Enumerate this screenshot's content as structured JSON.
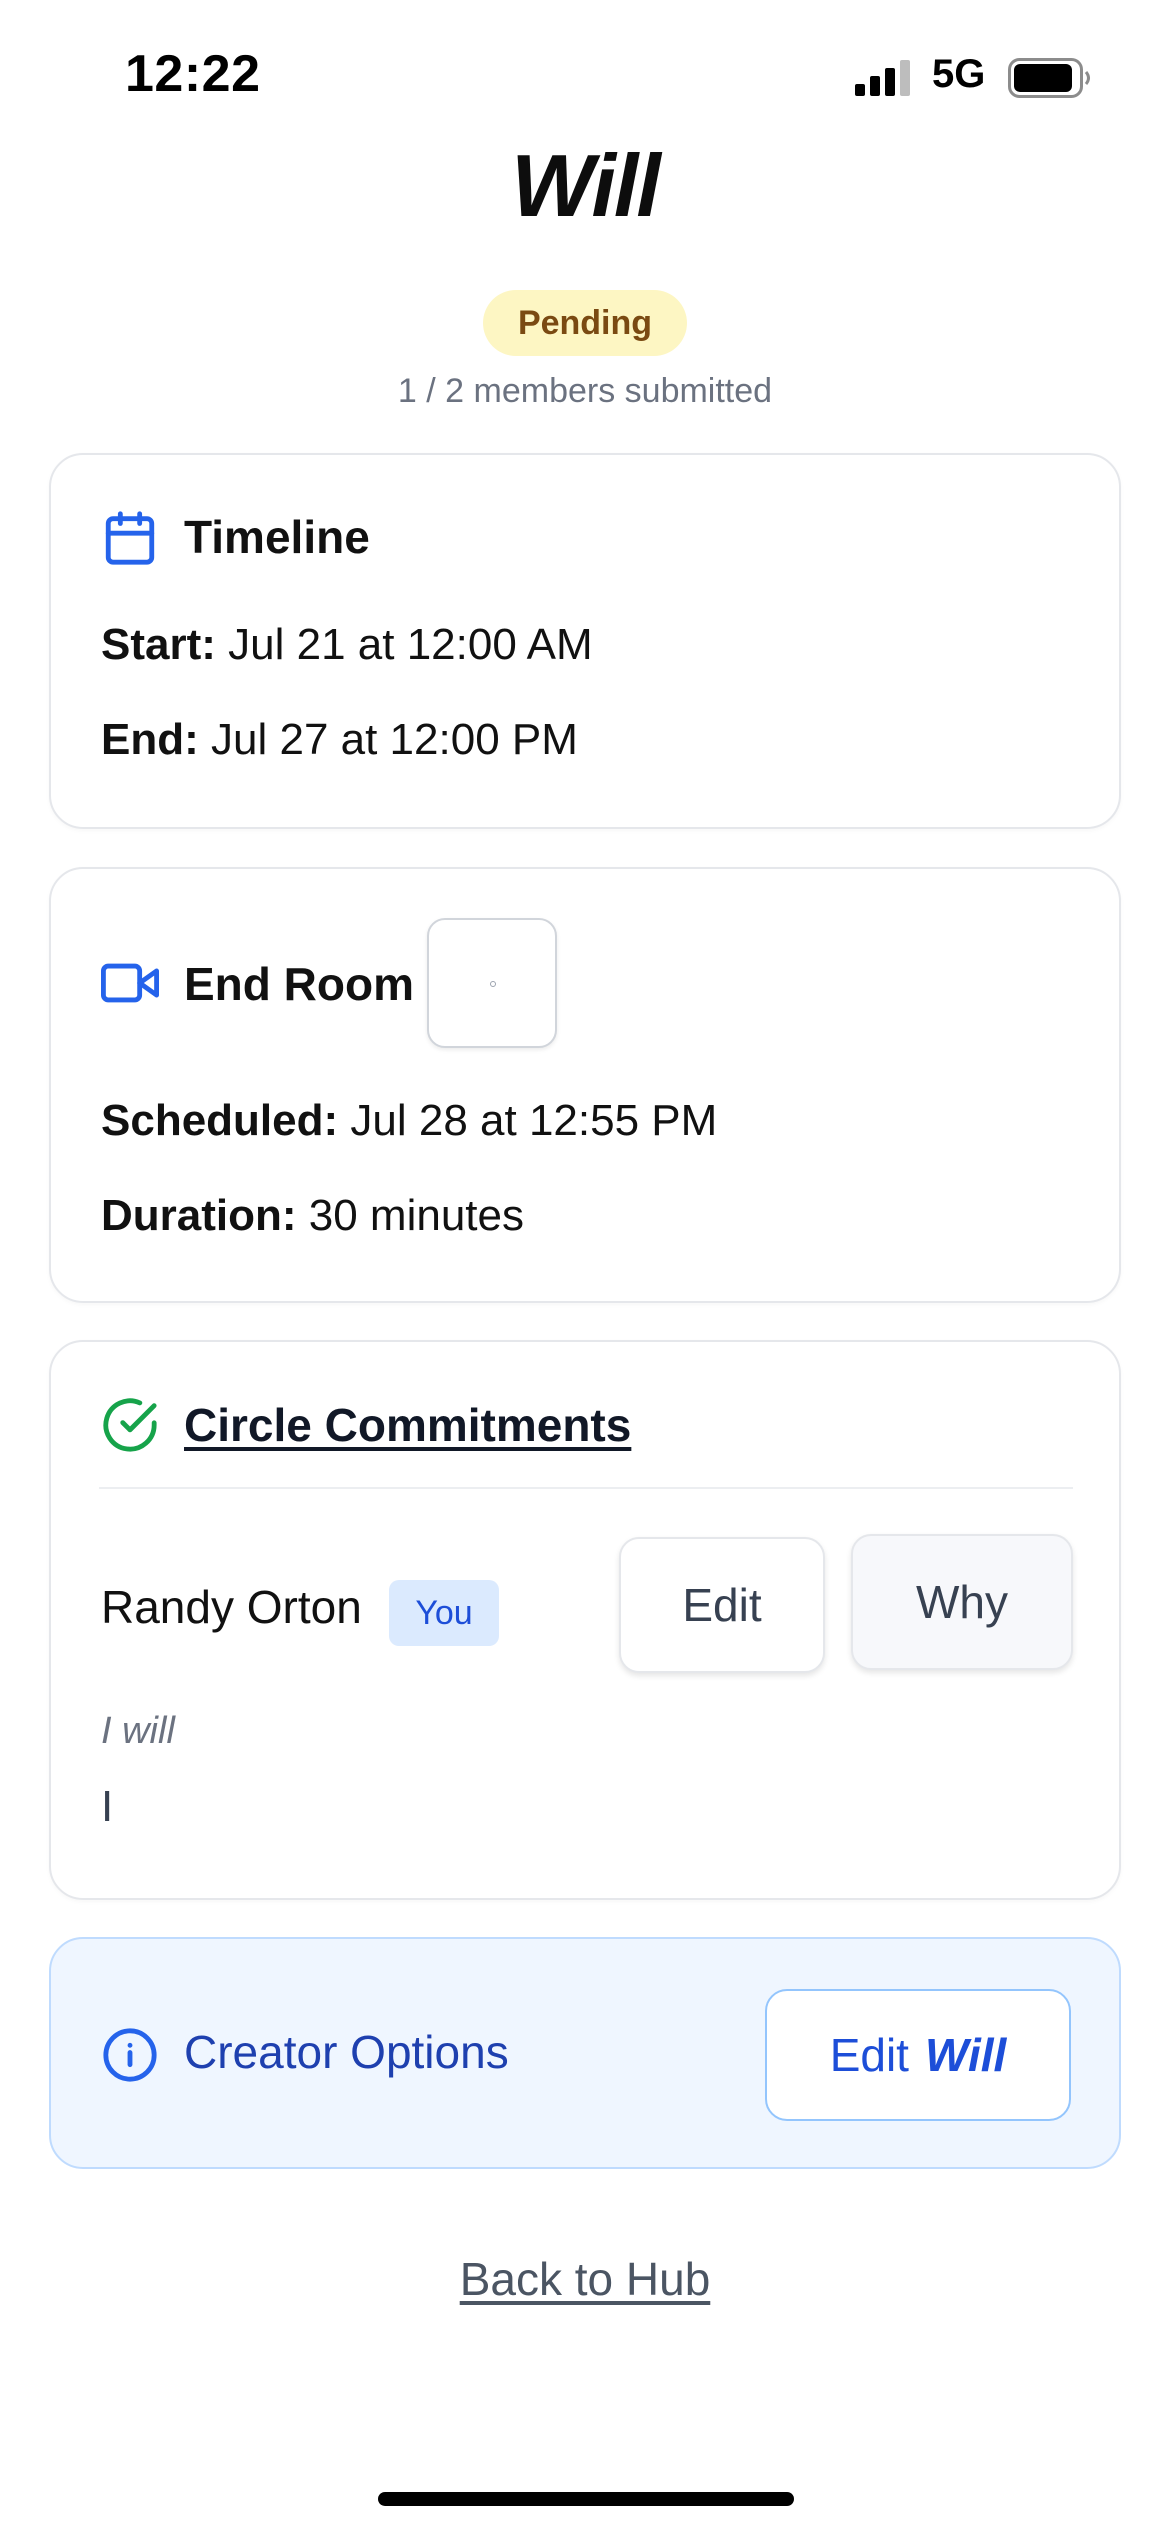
{
  "status_bar": {
    "time": "12:22",
    "network": "5G",
    "battery_level": 0.9
  },
  "header": {
    "title": "Will",
    "status": "Pending",
    "members_submitted": "1 / 2 members submitted"
  },
  "timeline": {
    "title": "Timeline",
    "icon": "calendar-icon",
    "start_label": "Start:",
    "start_value": "Jul 21 at 12:00 AM",
    "end_label": "End:",
    "end_value": "Jul 27 at 12:00 PM"
  },
  "end_room": {
    "title": "End Room",
    "icon": "video-camera-icon",
    "scheduled_label": "Scheduled:",
    "scheduled_value": "Jul 28 at 12:55 PM",
    "duration_label": "Duration:",
    "duration_value": "30 minutes"
  },
  "commitments": {
    "title": "Circle Commitments",
    "icon": "check-circle-icon",
    "members": [
      {
        "name": "Randy Orton",
        "badge": "You",
        "edit_label": "Edit",
        "why_label": "Why",
        "prefix": "I will",
        "text": "I"
      }
    ]
  },
  "creator_options": {
    "label": "Creator Options",
    "icon": "info-icon",
    "button_prefix": "Edit",
    "button_emphasis": "Will"
  },
  "back_link": "Back to Hub",
  "colors": {
    "accent_blue": "#2563eb",
    "success_green": "#16a34a",
    "pending_bg": "#fdf6c3",
    "pending_text": "#7a4a12"
  }
}
